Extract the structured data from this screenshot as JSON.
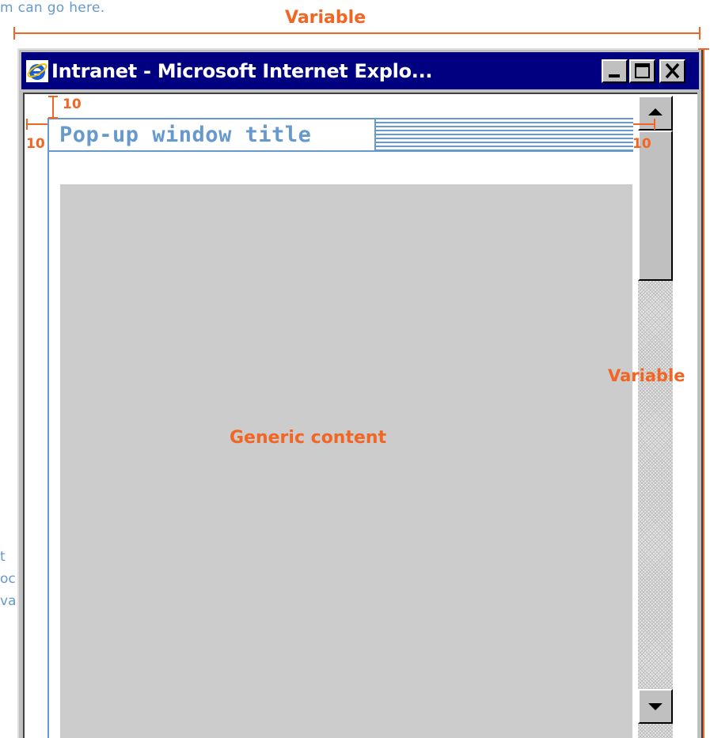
{
  "background_text": {
    "top": "m can go here.",
    "fragments": [
      "t",
      "oc",
      "va"
    ]
  },
  "annotations": {
    "width_label": "Variable",
    "height_label": "Variable",
    "top_margin": "10",
    "left_margin": "10",
    "right_margin": "10",
    "content_label": "Generic content"
  },
  "window": {
    "title": "Intranet - Microsoft Internet Explo...",
    "icon": "internet-explorer-icon",
    "controls": [
      "minimize-icon",
      "maximize-icon",
      "close-icon"
    ]
  },
  "popup": {
    "title": "Pop-up window title"
  },
  "colors": {
    "annotation": "#f26522",
    "popup_accent": "#6699cc",
    "titlebar": "#000080",
    "content_bg": "#cccccc"
  }
}
